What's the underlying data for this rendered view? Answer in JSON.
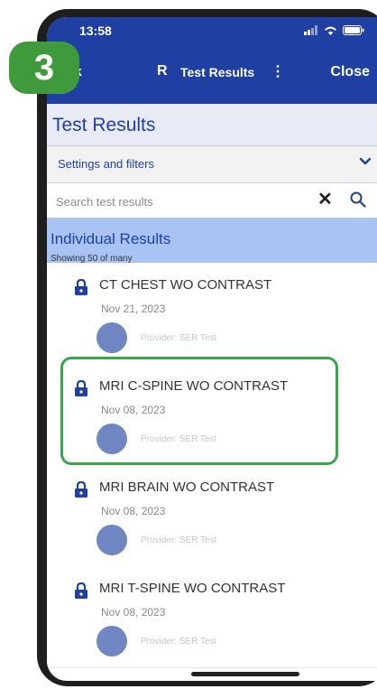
{
  "status_bar": {
    "time": "13:58"
  },
  "nav": {
    "back_label": "ck",
    "patient_initial": "R",
    "title": "Test Results",
    "menu_symbol": "⋮",
    "close_label": "Close"
  },
  "page": {
    "title": "Test Results"
  },
  "filters": {
    "label": "Settings and filters",
    "chevron": "⌄"
  },
  "search": {
    "placeholder": "Search test results",
    "clear_symbol": "✕"
  },
  "section": {
    "title": "Individual Results",
    "subtitle": "Showing 50 of many"
  },
  "results": [
    {
      "title": "CT CHEST WO CONTRAST",
      "date": "Nov 21, 2023",
      "provider": "Provider: SER Test"
    },
    {
      "title": "MRI C-SPINE WO CONTRAST",
      "date": "Nov 08, 2023",
      "provider": "Provider: SER Test"
    },
    {
      "title": "MRI BRAIN WO CONTRAST",
      "date": "Nov 08, 2023",
      "provider": "Provider: SER Test"
    },
    {
      "title": "MRI T-SPINE WO CONTRAST",
      "date": "Nov 08, 2023",
      "provider": "Provider: SER Test"
    }
  ],
  "step_badge": "3",
  "colors": {
    "brand_blue": "#1f3fa3",
    "section_blue": "#a9c3f5",
    "highlight_green": "#3aa64b",
    "badge_green": "#3e9a3a",
    "avatar_blue": "#6f86c3"
  },
  "icons": [
    "signal-icon",
    "wifi-icon",
    "battery-icon",
    "chevron-down-icon",
    "close-icon",
    "search-icon",
    "lock-icon"
  ]
}
